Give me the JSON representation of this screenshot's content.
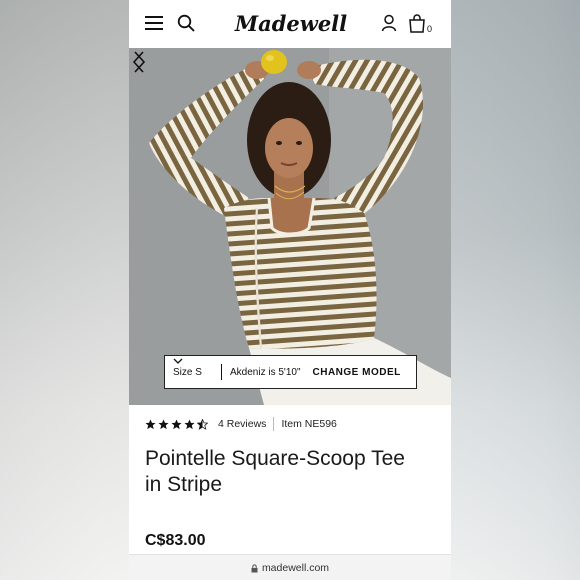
{
  "header": {
    "brand": "Madewell",
    "bag_count": "0"
  },
  "hero": {
    "model_size": "Size S",
    "model_height": "Akdeniz is 5'10\"",
    "change_model_label": "CHANGE MODEL"
  },
  "product": {
    "rating": 4.5,
    "reviews_label": "4 Reviews",
    "item_number": "Item NE596",
    "title_line1": "Pointelle Square-Scoop Tee",
    "title_line2": "in Stripe",
    "price": "C$83.00"
  },
  "browser": {
    "url": "madewell.com"
  },
  "colors": {
    "stripe_brown": "#7a6541",
    "stripe_cream": "#f3eee2",
    "lemon": "#e2c21c"
  },
  "icons": [
    "menu-icon",
    "search-icon",
    "account-icon",
    "bag-icon",
    "chevron-left-icon",
    "chevron-right-icon",
    "chevron-down-icon",
    "star-icon",
    "lock-icon"
  ]
}
